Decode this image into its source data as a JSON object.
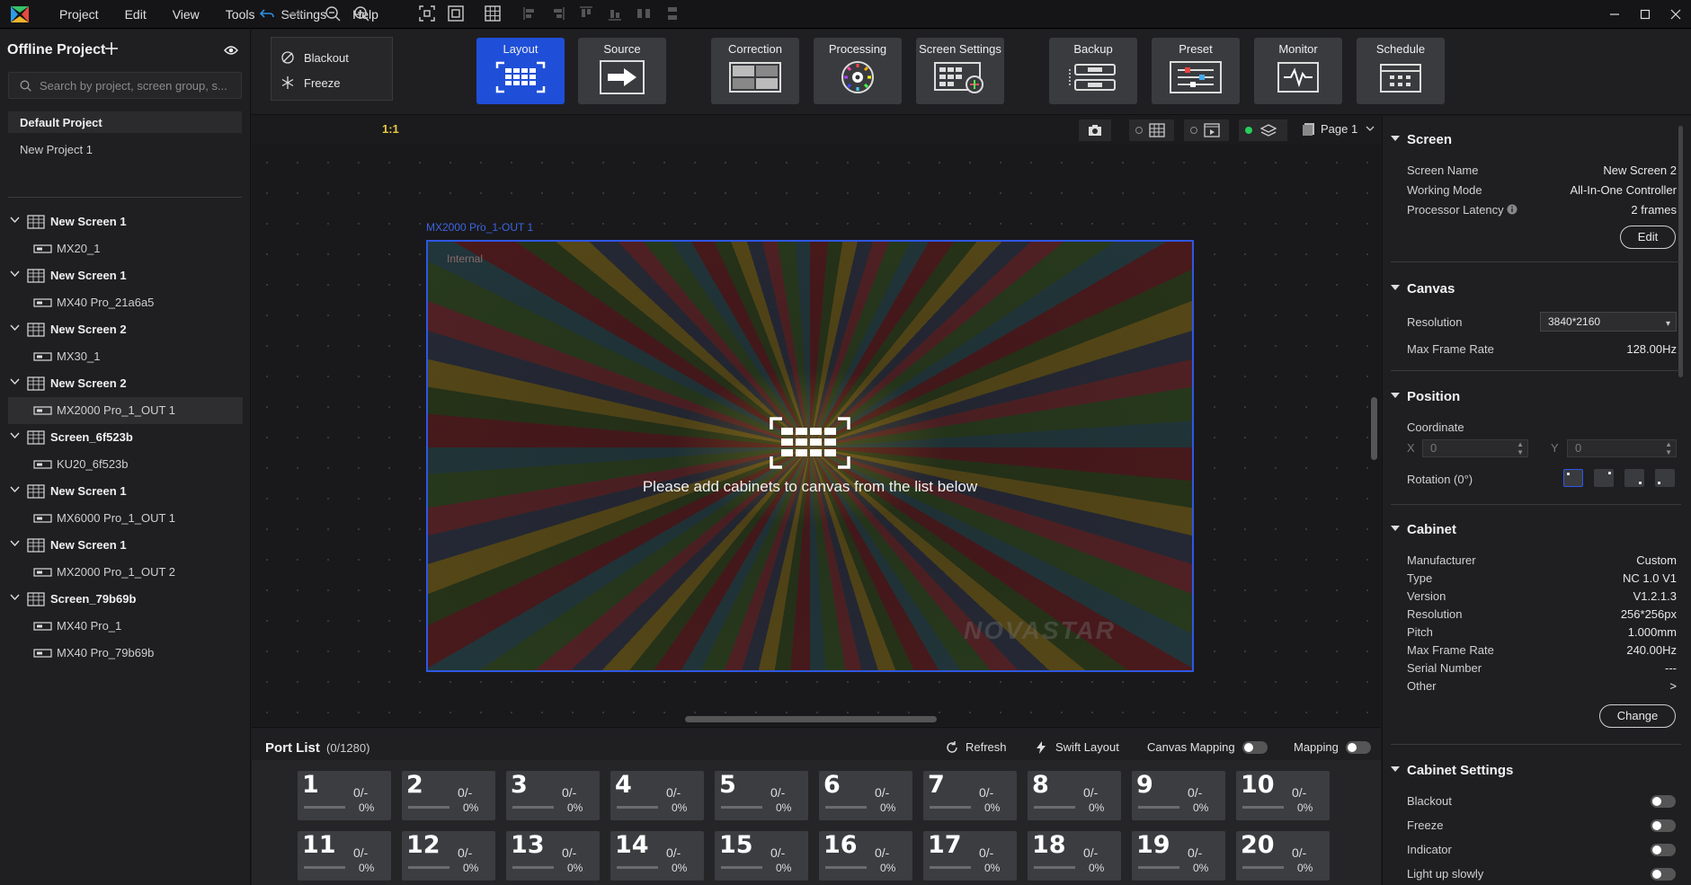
{
  "menubar": {
    "items": [
      "Project",
      "Edit",
      "View",
      "Tools",
      "Settings",
      "Help"
    ]
  },
  "left": {
    "project_title": "Offline Project",
    "search_placeholder": "Search by project, screen group, s...",
    "default_project": "Default Project",
    "new_project": "New Project 1",
    "tree": [
      {
        "screen": "New Screen 1",
        "device": "MX20_1"
      },
      {
        "screen": "New Screen 1",
        "device": "MX40 Pro_21a6a5"
      },
      {
        "screen": "New Screen 2",
        "device": "MX30_1"
      },
      {
        "screen": "New Screen 2",
        "device": "MX2000 Pro_1_OUT 1"
      },
      {
        "screen": "Screen_6f523b",
        "device": "KU20_6f523b"
      },
      {
        "screen": "New Screen 1",
        "device": "MX6000 Pro_1_OUT 1"
      },
      {
        "screen": "New Screen 1",
        "device": "MX2000 Pro_1_OUT 2"
      },
      {
        "screen": "Screen_79b69b",
        "device": "MX40 Pro_1"
      },
      {
        "screen": "",
        "device": "MX40 Pro_79b69b"
      }
    ]
  },
  "toolbar": {
    "blackout": "Blackout",
    "freeze": "Freeze",
    "buttons": [
      "Layout",
      "Source",
      "Correction",
      "Processing",
      "Screen Settings",
      "Backup",
      "Preset",
      "Monitor",
      "Schedule"
    ],
    "zoom_label": "1:1",
    "page_label": "Page 1"
  },
  "canvas": {
    "output_label": "MX2000 Pro_1-OUT 1",
    "internal_label": "Internal",
    "watermark": "NOVASTAR",
    "message": "Please add cabinets to canvas from the list below"
  },
  "portlist": {
    "title": "Port List",
    "count": "(0/1280)",
    "refresh": "Refresh",
    "swift_layout": "Swift Layout",
    "canvas_mapping": "Canvas Mapping",
    "mapping": "Mapping",
    "ports": [
      {
        "num": "1",
        "frac": "0/-",
        "pct": "0%"
      },
      {
        "num": "2",
        "frac": "0/-",
        "pct": "0%"
      },
      {
        "num": "3",
        "frac": "0/-",
        "pct": "0%"
      },
      {
        "num": "4",
        "frac": "0/-",
        "pct": "0%"
      },
      {
        "num": "5",
        "frac": "0/-",
        "pct": "0%"
      },
      {
        "num": "6",
        "frac": "0/-",
        "pct": "0%"
      },
      {
        "num": "7",
        "frac": "0/-",
        "pct": "0%"
      },
      {
        "num": "8",
        "frac": "0/-",
        "pct": "0%"
      },
      {
        "num": "9",
        "frac": "0/-",
        "pct": "0%"
      },
      {
        "num": "10",
        "frac": "0/-",
        "pct": "0%"
      },
      {
        "num": "11",
        "frac": "0/-",
        "pct": "0%"
      },
      {
        "num": "12",
        "frac": "0/-",
        "pct": "0%"
      },
      {
        "num": "13",
        "frac": "0/-",
        "pct": "0%"
      },
      {
        "num": "14",
        "frac": "0/-",
        "pct": "0%"
      },
      {
        "num": "15",
        "frac": "0/-",
        "pct": "0%"
      },
      {
        "num": "16",
        "frac": "0/-",
        "pct": "0%"
      },
      {
        "num": "17",
        "frac": "0/-",
        "pct": "0%"
      },
      {
        "num": "18",
        "frac": "0/-",
        "pct": "0%"
      },
      {
        "num": "19",
        "frac": "0/-",
        "pct": "0%"
      },
      {
        "num": "20",
        "frac": "0/-",
        "pct": "0%"
      }
    ]
  },
  "right": {
    "screen": {
      "title": "Screen",
      "name_label": "Screen Name",
      "name_value": "New Screen 2",
      "mode_label": "Working Mode",
      "mode_value": "All-In-One Controller",
      "latency_label": "Processor Latency",
      "latency_value": "2 frames",
      "edit": "Edit"
    },
    "canvas": {
      "title": "Canvas",
      "res_label": "Resolution",
      "res_value": "3840*2160",
      "rate_label": "Max Frame Rate",
      "rate_value": "128.00Hz"
    },
    "position": {
      "title": "Position",
      "coord_label": "Coordinate",
      "x_label": "X",
      "x_value": "0",
      "y_label": "Y",
      "y_value": "0",
      "rotation_label": "Rotation (0°)"
    },
    "cabinet": {
      "title": "Cabinet",
      "rows": [
        {
          "k": "Manufacturer",
          "v": "Custom"
        },
        {
          "k": "Type",
          "v": "NC 1.0 V1"
        },
        {
          "k": "Version",
          "v": "V1.2.1.3"
        },
        {
          "k": "Resolution",
          "v": "256*256px"
        },
        {
          "k": "Pitch",
          "v": "1.000mm"
        },
        {
          "k": "Max Frame Rate",
          "v": "240.00Hz"
        },
        {
          "k": "Serial Number",
          "v": "---"
        },
        {
          "k": "Other",
          "v": ">"
        }
      ],
      "change": "Change"
    },
    "cabinet_settings": {
      "title": "Cabinet Settings",
      "items": [
        "Blackout",
        "Freeze",
        "Indicator",
        "Light up slowly"
      ]
    }
  },
  "colors": {
    "accent": "#1f4fd8",
    "background": "#1b1b1e",
    "panel": "#1f1f22"
  }
}
